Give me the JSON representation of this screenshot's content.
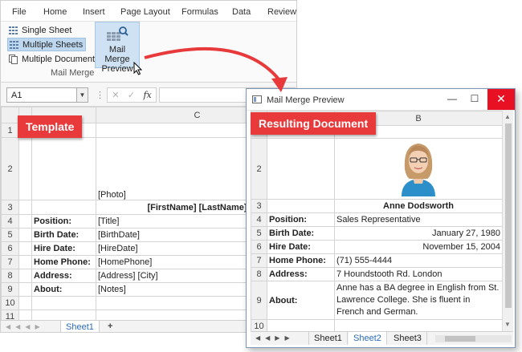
{
  "ribbon": {
    "tabs": [
      "File",
      "Home",
      "Insert",
      "Page Layout",
      "Formulas",
      "Data",
      "Review"
    ],
    "items": {
      "single_sheet": "Single Sheet",
      "multiple_sheets": "Multiple Sheets",
      "multiple_documents": "Multiple Documents"
    },
    "mail_merge_preview_line1": "Mail Merge",
    "mail_merge_preview_line2": "Preview",
    "group_label": "Mail Merge"
  },
  "formula_bar": {
    "name_box": "A1",
    "separator": "⋮",
    "cancel": "✕",
    "enter": "✓",
    "fx": "fx"
  },
  "template": {
    "callout": "Template",
    "column_header": "C",
    "rows": [
      {
        "num": "1",
        "label": "",
        "value": ""
      },
      {
        "num": "2",
        "label": "",
        "value": "[Photo]"
      },
      {
        "num": "3",
        "label": "",
        "value": "[FirstName] [LastName]"
      },
      {
        "num": "4",
        "label": "Position:",
        "value": "[Title]"
      },
      {
        "num": "5",
        "label": "Birth Date:",
        "value": "[BirthDate]"
      },
      {
        "num": "6",
        "label": "Hire Date:",
        "value": "[HireDate]"
      },
      {
        "num": "7",
        "label": "Home Phone:",
        "value": "[HomePhone]"
      },
      {
        "num": "8",
        "label": "Address:",
        "value": "[Address] [City]"
      },
      {
        "num": "9",
        "label": "About:",
        "value": "[Notes]"
      },
      {
        "num": "10",
        "label": "",
        "value": ""
      },
      {
        "num": "11",
        "label": "",
        "value": ""
      }
    ],
    "sheet_tab": "Sheet1",
    "add_sheet": "+"
  },
  "preview": {
    "title": "Mail Merge Preview",
    "callout": "Resulting Document",
    "column_header": "B",
    "rows": [
      {
        "num": "1",
        "label": "",
        "value": ""
      },
      {
        "num": "2",
        "label": "",
        "value": ""
      },
      {
        "num": "3",
        "label": "",
        "value": "Anne Dodsworth"
      },
      {
        "num": "4",
        "label": "Position:",
        "value": "Sales Representative"
      },
      {
        "num": "5",
        "label": "Birth Date:",
        "value": "January 27, 1980"
      },
      {
        "num": "6",
        "label": "Hire Date:",
        "value": "November 15, 2004"
      },
      {
        "num": "7",
        "label": "Home Phone:",
        "value": "(71) 555-4444"
      },
      {
        "num": "8",
        "label": "Address:",
        "value": "7 Houndstooth Rd. London"
      },
      {
        "num": "9",
        "label": "About:",
        "value_lines": [
          "Anne has a BA degree in English from St.",
          "Lawrence College.  She is fluent in",
          "French and German."
        ]
      },
      {
        "num": "10",
        "label": "",
        "value": ""
      }
    ],
    "sheet_tabs": [
      "Sheet1",
      "Sheet2",
      "Sheet3"
    ],
    "active_sheet": "Sheet2"
  },
  "colors": {
    "callout": "#e8393b",
    "arrow": "#e8393b",
    "link_tab": "#2a6cb5",
    "close_button": "#e81123"
  }
}
